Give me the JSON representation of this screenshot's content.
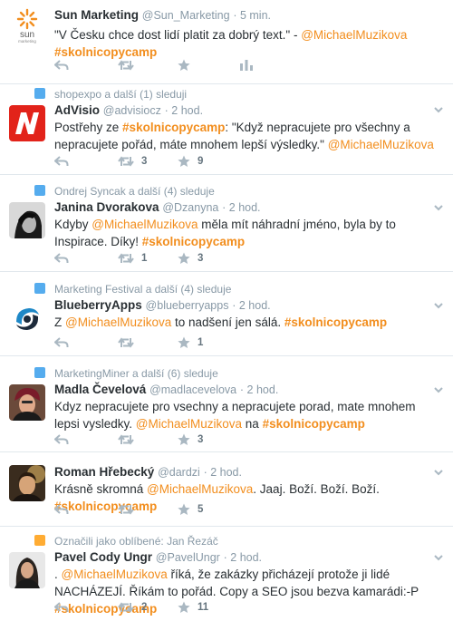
{
  "colors": {
    "accent": "#f28e1e",
    "icon": "#aab8c2",
    "meta": "#8899a6",
    "border": "#e1e8ed"
  },
  "tweets": [
    {
      "avatar": "sun-marketing-logo",
      "avatar_text": {
        "main": "sun",
        "sub": "marketing"
      },
      "name": "Sun Marketing",
      "handle": "@Sun_Marketing",
      "time": "5 min.",
      "text": [
        {
          "t": "\"V Česku chce dost lidí platit za dobrý text.\" - "
        },
        {
          "t": "@MichaelMuzikova",
          "k": "m"
        },
        {
          "t": " "
        },
        {
          "t": "#skolnicopycamp",
          "k": "h"
        }
      ],
      "retweets": "",
      "favorites": ""
    },
    {
      "context": "shopexpo a další (1) sleduji",
      "avatar": "advisio-logo",
      "name": "AdVisio",
      "handle": "@advisiocz",
      "time": "2 hod.",
      "text": [
        {
          "t": "Postřehy ze "
        },
        {
          "t": "#skolnicopycamp",
          "k": "h"
        },
        {
          "t": ": \"Když nepracujete pro všechny a nepracujete pořád, máte mnohem lepší výsledky.\" "
        },
        {
          "t": "@MichaelMuzikova",
          "k": "m"
        }
      ],
      "retweets": "3",
      "favorites": "9"
    },
    {
      "context": "Ondrej Syncak a další (4) sleduje",
      "avatar": "janina-photo",
      "name": "Janina Dvorakova",
      "handle": "@Dzanyna",
      "time": "2 hod.",
      "text": [
        {
          "t": "Kdyby "
        },
        {
          "t": "@MichaelMuzikova",
          "k": "m"
        },
        {
          "t": " měla mít náhradní jméno, byla by to Inspirace. Díky! "
        },
        {
          "t": "#skolnicopycamp",
          "k": "h"
        }
      ],
      "retweets": "1",
      "favorites": "3"
    },
    {
      "context": "Marketing Festival a další (4) sleduje",
      "avatar": "blueberryapps-logo",
      "name": "BlueberryApps",
      "handle": "@blueberryapps",
      "time": "2 hod.",
      "text": [
        {
          "t": "Z "
        },
        {
          "t": "@MichaelMuzikova",
          "k": "m"
        },
        {
          "t": " to nadšení jen sálá. "
        },
        {
          "t": "#skolnicopycamp",
          "k": "h"
        }
      ],
      "retweets": "",
      "favorites": "1"
    },
    {
      "context": "MarketingMiner a další (6) sleduje",
      "avatar": "madla-photo",
      "name": "Madla Čevelová",
      "handle": "@madlacevelova",
      "time": "2 hod.",
      "text": [
        {
          "t": "Kdyz nepracujete pro vsechny a nepracujete porad, mate mnohem lepsi vysledky. "
        },
        {
          "t": "@MichaelMuzikova",
          "k": "m"
        },
        {
          "t": " na "
        },
        {
          "t": "#skolnicopycamp",
          "k": "h"
        }
      ],
      "retweets": "",
      "favorites": "3"
    },
    {
      "avatar": "roman-photo",
      "name": "Roman Hřebecký",
      "handle": "@dardzi",
      "time": "2 hod.",
      "text": [
        {
          "t": "Krásně skromná "
        },
        {
          "t": "@MichaelMuzikova",
          "k": "m"
        },
        {
          "t": ". Jaaj. Boží. Boží. Boží. "
        },
        {
          "t": "#skolnicopycamp",
          "k": "h"
        }
      ],
      "retweets": "",
      "favorites": "5"
    },
    {
      "context": "Označili jako oblíbené: Jan Řezáč",
      "avatar": "pavel-photo",
      "name": "Pavel Cody Ungr",
      "handle": "@PavelUngr",
      "time": "2 hod.",
      "text": [
        {
          "t": ". "
        },
        {
          "t": "@MichaelMuzikova",
          "k": "m"
        },
        {
          "t": " říká, že zakázky přicházejí protože ji lidé NACHÁZEJÍ. Říkám to pořád. Copy a SEO jsou bezva kamarádi:-P  "
        },
        {
          "t": "#skolnicopycamp",
          "k": "h"
        }
      ],
      "retweets": "2",
      "favorites": "11"
    }
  ]
}
